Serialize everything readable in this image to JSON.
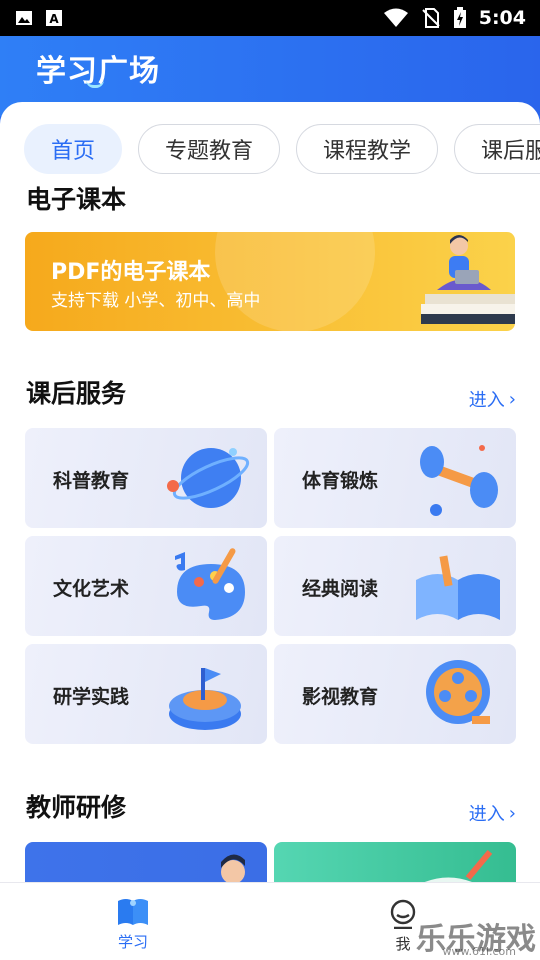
{
  "status_bar": {
    "time": "5:04",
    "icons": [
      "image-icon",
      "text-a-icon",
      "wifi-icon",
      "no-sim-icon",
      "battery-charging-icon"
    ]
  },
  "header": {
    "title": "学习广场"
  },
  "tabs": [
    {
      "label": "首页",
      "active": true
    },
    {
      "label": "专题教育",
      "active": false
    },
    {
      "label": "课程教学",
      "active": false
    },
    {
      "label": "课后服",
      "active": false
    }
  ],
  "textbook": {
    "title": "电子课本",
    "banner_title": "PDF的电子课本",
    "banner_subtitle": "支持下载 小学、初中、高中"
  },
  "after_school": {
    "title": "课后服务",
    "enter_label": "进入",
    "items": [
      {
        "label": "科普教育",
        "icon": "globe-icon"
      },
      {
        "label": "体育锻炼",
        "icon": "dumbbell-icon"
      },
      {
        "label": "文化艺术",
        "icon": "palette-icon"
      },
      {
        "label": "经典阅读",
        "icon": "open-book-icon"
      },
      {
        "label": "研学实践",
        "icon": "flag-platform-icon"
      },
      {
        "label": "影视教育",
        "icon": "film-reel-icon"
      }
    ]
  },
  "teacher": {
    "title": "教师研修",
    "enter_label": "进入"
  },
  "bottom_nav": {
    "items": [
      {
        "label": "学习",
        "icon": "book-icon",
        "active": true
      },
      {
        "label": "我",
        "icon": "profile-icon",
        "active": false
      }
    ]
  },
  "watermark": {
    "text": "乐乐游戏",
    "sub": "www.61l.com"
  },
  "colors": {
    "brand": "#2a6df4",
    "banner": "#f8b52a",
    "card": "#e8ebf8"
  }
}
